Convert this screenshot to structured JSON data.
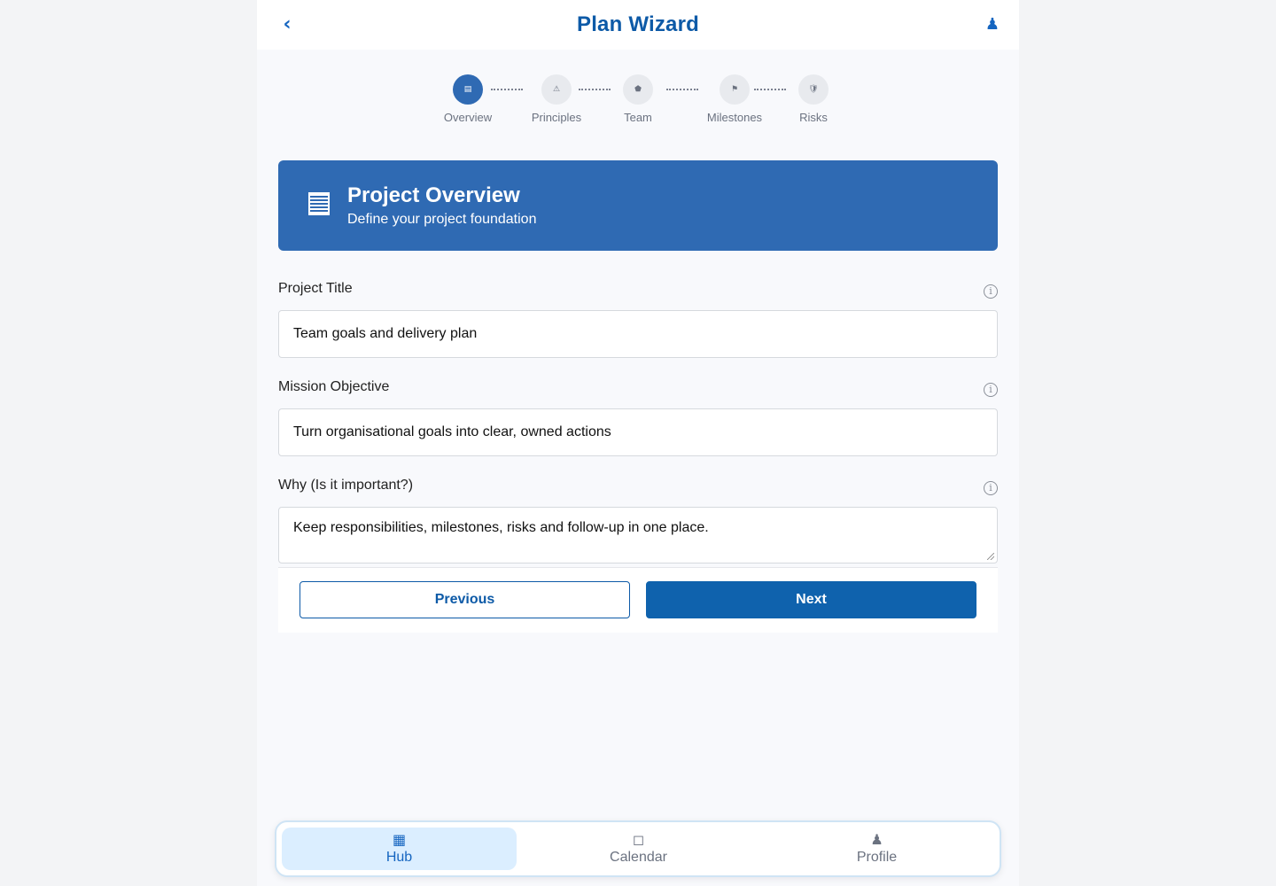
{
  "header": {
    "title": "Plan Wizard",
    "back_icon": "‹",
    "profile_icon": "♟"
  },
  "stepper": {
    "steps": [
      {
        "label": "Overview",
        "icon": "▤",
        "active": true
      },
      {
        "label": "Principles",
        "icon": "⚠",
        "active": false
      },
      {
        "label": "Team",
        "icon": "⬟",
        "active": false
      },
      {
        "label": "Milestones",
        "icon": "⚑",
        "active": false
      },
      {
        "label": "Risks",
        "icon": "🛡",
        "active": false
      }
    ]
  },
  "hero": {
    "title": "Project Overview",
    "subtitle": "Define your project foundation"
  },
  "form": {
    "project_title": {
      "label": "Project Title",
      "value": "Team goals and delivery plan"
    },
    "mission_objective": {
      "label": "Mission Objective",
      "value": "Turn organisational goals into clear, owned actions"
    },
    "why": {
      "label": "Why (Is it important?)",
      "value": "Keep responsibilities, milestones, risks and follow-up in one place."
    },
    "info_glyph": "i"
  },
  "buttons": {
    "previous": "Previous",
    "next": "Next"
  },
  "bottom_nav": {
    "items": [
      {
        "label": "Hub",
        "icon": "▦"
      },
      {
        "label": "Calendar",
        "icon": "◻"
      },
      {
        "label": "Profile",
        "icon": "♟"
      }
    ]
  },
  "colors": {
    "accent": "#2f6ab3",
    "title": "#0d5aa7",
    "primary_button": "#0f62ad"
  }
}
